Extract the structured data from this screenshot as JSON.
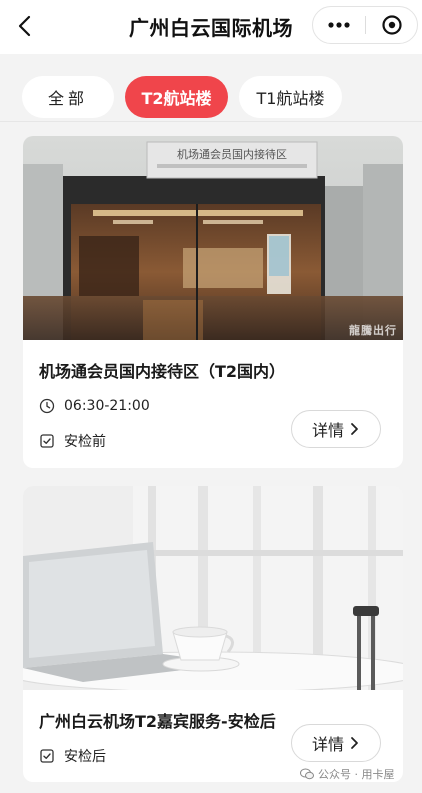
{
  "header": {
    "title": "广州白云国际机场"
  },
  "tabs": [
    {
      "label": "全部",
      "active": false
    },
    {
      "label": "T2航站楼",
      "active": true
    },
    {
      "label": "T1航站楼",
      "active": false
    }
  ],
  "cards": [
    {
      "title": "机场通会员国内接待区（T2国内）",
      "hours": "06:30-21:00",
      "security": "安检前",
      "detail_label": "详情",
      "image_sign": "机场通会员国内接待区",
      "image_watermark": "龍騰出行"
    },
    {
      "title": "广州白云机场T2嘉宾服务-安检后",
      "security": "安检后",
      "detail_label": "详情"
    }
  ],
  "footer_watermark": "公众号 · 用卡屋",
  "colors": {
    "accent": "#f0454b",
    "background": "#f3f3f3"
  }
}
